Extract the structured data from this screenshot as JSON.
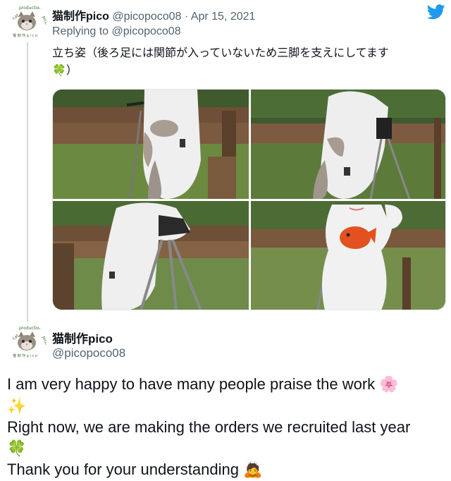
{
  "tweet": {
    "display_name": "猫制作pico",
    "handle": "@picopoco08",
    "separator": "·",
    "date": "Apr 15, 2021",
    "replying_prefix": "Replying to",
    "replying_handle": "@picopoco08",
    "text_line1": "立ち姿（後ろ足には関節が入っていないため三脚を支えにしてます",
    "text_line2_emoji": "🍀",
    "text_line2_rest": "）",
    "photos": [
      "photo-1",
      "photo-2",
      "photo-3",
      "photo-4"
    ]
  },
  "reply": {
    "display_name": "猫制作pico",
    "handle": "@picopoco08",
    "line1": "I am very happy to have many people praise the work",
    "line1_emoji": "🌸",
    "line2_emoji": "✨",
    "line3": "Right now, we are making the orders we recruited last year",
    "line4_emoji": "🍀",
    "line5": "Thank you for your understanding",
    "line5_emoji": "🙇"
  },
  "avatar_text": "cat production pico 猫制作",
  "icons": {
    "brand": "twitter-bird-icon"
  },
  "colors": {
    "brand": "#1d9bf0",
    "muted": "#536471",
    "thread": "#cfd9de"
  }
}
